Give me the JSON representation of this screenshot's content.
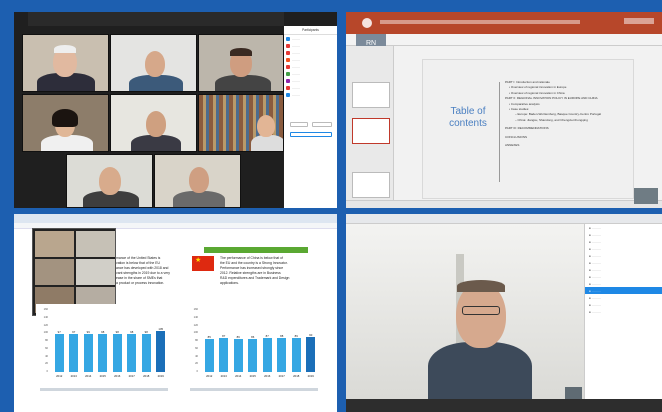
{
  "quadrants": {
    "top_left": {
      "label": "Video conference gallery view"
    },
    "top_right": {
      "label": "Presentation slide"
    },
    "bottom_left": {
      "label": "Innovation scoreboard report"
    },
    "bottom_right": {
      "label": "Video call speaker view"
    }
  },
  "slide": {
    "title_line1": "Table of",
    "title_line2": "contents",
    "user_initials": "RN",
    "items": [
      "PART I: Introduction and rationale",
      "• Overview of regional innovation in Europe",
      "• Overview of regional innovation in China",
      "PART II: REGIONAL INNOVATION POLICY IN EUROPE AND CHINA",
      "• Comparative analysis",
      "• Case studies:",
      "– Europe: Baden-Wurttemberg, Basque Country-Centro Portugal",
      "– China: Jiangsu, Shandong, and Chengdu-Chongqing",
      "PART III: RECOMMENDATIONS",
      "CONCLUSIONS",
      "ANNEXES"
    ]
  },
  "report": {
    "left_text": [
      "mance of the United States is",
      "vation is below that of the EU",
      "ance has developed with 2018 and",
      "vant strengths in 2019 due to a very",
      "ease in the share of SMEs that",
      "a product or process innovation."
    ],
    "right_text": [
      "The performance of China is below that of",
      "the EU and the country is a Strong Innovator.",
      "Performance has increased strongly since",
      "2012. Relative strengths are in Business",
      "R&D expenditures and Trademark and Design",
      "applications."
    ],
    "left_chart": {
      "values": [
        97,
        97,
        99,
        98,
        98,
        98,
        98,
        105
      ]
    },
    "right_chart": {
      "values": [
        85,
        87,
        86,
        86,
        87,
        88,
        89,
        90
      ]
    },
    "years": [
      "2012",
      "2013",
      "2014",
      "2015",
      "2016",
      "2017",
      "2018",
      "2019"
    ],
    "y_ticks": [
      "160",
      "140",
      "120",
      "100",
      "80",
      "60",
      "40",
      "20",
      "0"
    ]
  },
  "colors": {
    "accent": "#35a7e3",
    "ppt_ribbon": "#b7472a",
    "slide_title": "#4a7fc1",
    "frame": "#1d5fb0"
  }
}
